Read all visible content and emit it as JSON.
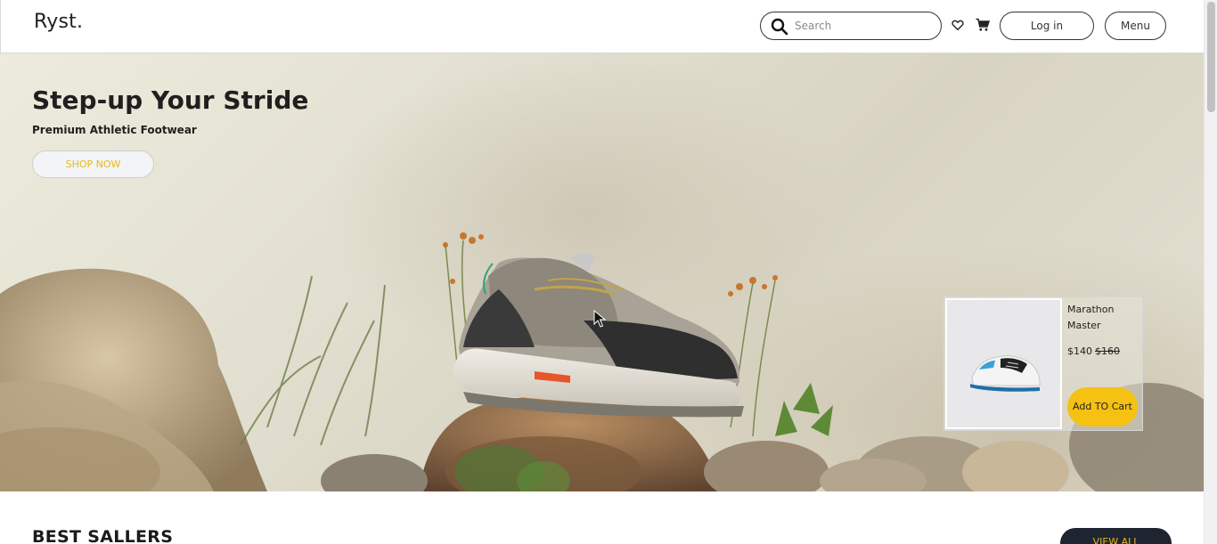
{
  "header": {
    "logo": "Ryst.",
    "search_placeholder": "Search",
    "login_label": "Log in",
    "menu_label": "Menu"
  },
  "hero": {
    "title": "Step-up Your Stride",
    "subtitle": "Premium Athletic Footwear",
    "cta_label": "SHOP NOW"
  },
  "product_card": {
    "name": "Marathon Master",
    "price": "$140",
    "old_price": "$160",
    "add_label": "Add TO Cart"
  },
  "best_sellers": {
    "title": "BEST SALLERS",
    "view_all_label": "VIEW ALL"
  },
  "icons": {
    "search": "search-icon",
    "wishlist": "heart-icon",
    "cart": "cart-icon"
  },
  "colors": {
    "accent_yellow": "#f5c112",
    "cta_text": "#e6b91a",
    "dark_button": "#1e2430"
  }
}
